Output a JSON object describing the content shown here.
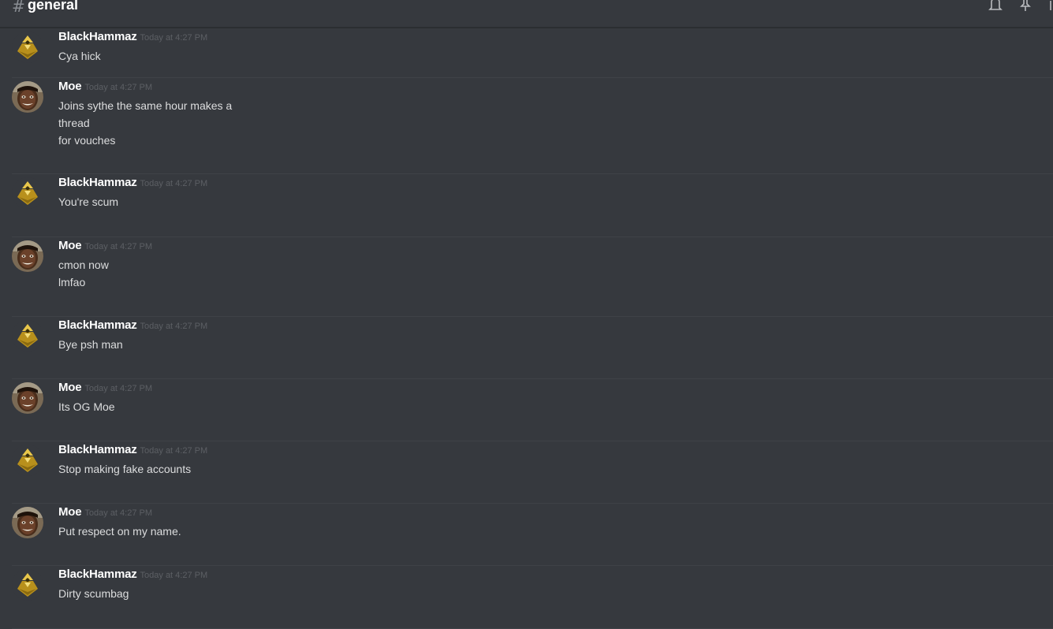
{
  "header": {
    "hash": "#",
    "channel": "general",
    "icons": [
      "bell-icon",
      "pin-icon",
      "members-icon"
    ]
  },
  "users": {
    "blackhammaz": {
      "name": "BlackHammaz",
      "avatar": "gold-emblem-avatar",
      "color": "#c9a227"
    },
    "moe": {
      "name": "Moe",
      "avatar": "photo-avatar"
    }
  },
  "messages": [
    {
      "author": "BlackHammaz",
      "timestamp": "Today at 4:27 PM",
      "lines": [
        "Cya hick"
      ]
    },
    {
      "author": "Moe",
      "timestamp": "Today at 4:27 PM",
      "lines": [
        "Joins sythe the same hour makes a",
        "thread",
        "for vouches"
      ]
    },
    {
      "author": "BlackHammaz",
      "timestamp": "Today at 4:27 PM",
      "lines": [
        "You're scum"
      ]
    },
    {
      "author": "Moe",
      "timestamp": "Today at 4:27 PM",
      "lines": [
        "cmon now",
        "lmfao"
      ]
    },
    {
      "author": "BlackHammaz",
      "timestamp": "Today at 4:27 PM",
      "lines": [
        "Bye psh man"
      ]
    },
    {
      "author": "Moe",
      "timestamp": "Today at 4:27 PM",
      "lines": [
        "Its OG Moe"
      ]
    },
    {
      "author": "BlackHammaz",
      "timestamp": "Today at 4:27 PM",
      "lines": [
        "Stop making fake accounts"
      ]
    },
    {
      "author": "Moe",
      "timestamp": "Today at 4:27 PM",
      "lines": [
        "Put respect on my name."
      ]
    },
    {
      "author": "BlackHammaz",
      "timestamp": "Today at 4:27 PM",
      "lines": [
        "Dirty scumbag"
      ]
    }
  ],
  "colors": {
    "background": "#36393e",
    "text": "#dcddde",
    "timestamp": "#5c5f64",
    "divider": "#3f4247"
  }
}
